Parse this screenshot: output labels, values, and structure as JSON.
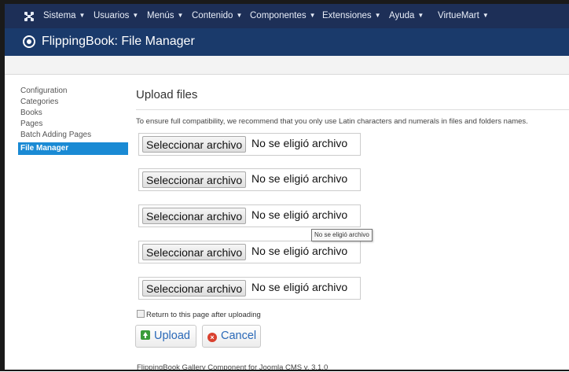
{
  "navbar": {
    "logo_icon": "joomla-logo-icon",
    "items": [
      {
        "label": "Sistema"
      },
      {
        "label": "Usuarios"
      },
      {
        "label": "Menús"
      },
      {
        "label": "Contenido"
      },
      {
        "label": "Componentes"
      },
      {
        "label": "Extensiones"
      },
      {
        "label": "Ayuda"
      },
      {
        "label": "VirtueMart"
      }
    ]
  },
  "header": {
    "title": "FlippingBook: File Manager",
    "icon": "circle-dot-icon"
  },
  "sidebar": {
    "items": [
      {
        "label": "Configuration"
      },
      {
        "label": "Categories"
      },
      {
        "label": "Books"
      },
      {
        "label": "Pages"
      },
      {
        "label": "Batch Adding Pages"
      },
      {
        "label": "File Manager",
        "active": true
      }
    ]
  },
  "main": {
    "section_title": "Upload files",
    "notice": "To ensure full compatibility, we recommend that you only use Latin characters and numerals in files and folders names.",
    "file_inputs": [
      {
        "button_label": "Seleccionar archivo",
        "status": "No se eligió archivo"
      },
      {
        "button_label": "Seleccionar archivo",
        "status": "No se eligió archivo"
      },
      {
        "button_label": "Seleccionar archivo",
        "status": "No se eligió archivo"
      },
      {
        "button_label": "Seleccionar archivo",
        "status": "No se eligió archivo"
      },
      {
        "button_label": "Seleccionar archivo",
        "status": "No se eligió archivo"
      }
    ],
    "tooltip": "No se eligió archivo",
    "return_checkbox": {
      "label": "Return to this page after uploading",
      "checked": false
    },
    "upload_label": "Upload",
    "cancel_label": "Cancel"
  },
  "footer": "FlippingBook Gallery Component for Joomla CMS v. 3.1.0",
  "colors": {
    "navbar": "#1d2f57",
    "titlebar": "#1a3a6b",
    "active_item": "#1a8ad4",
    "button_text": "#2a69b8"
  }
}
